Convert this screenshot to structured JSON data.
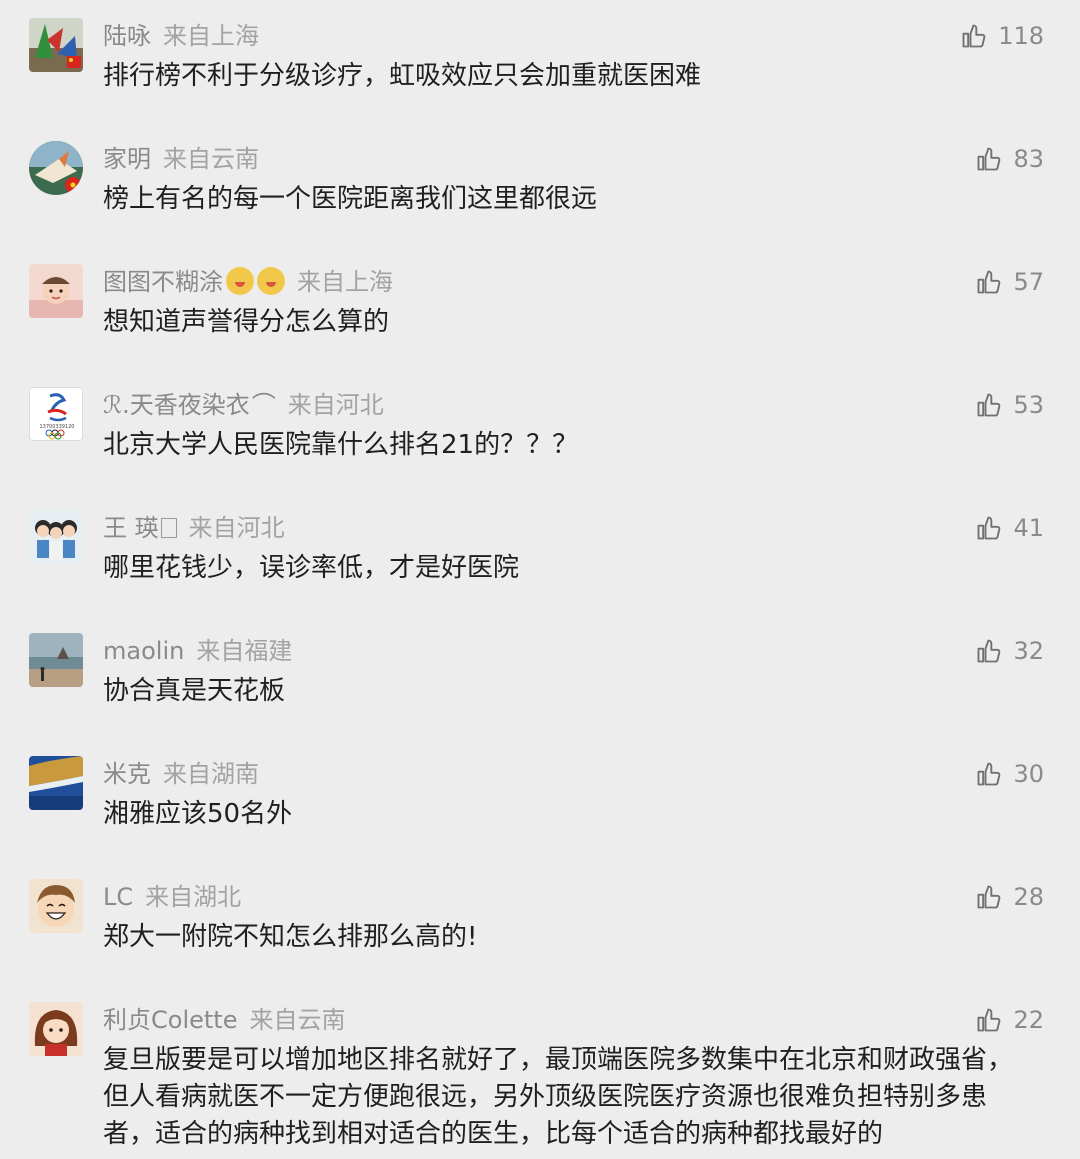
{
  "comments": [
    {
      "user": "陆咏",
      "location": "来自上海",
      "likes": "118",
      "text": "排行榜不利于分级诊疗，虹吸效应只会加重就医困难",
      "avatar": "avatar-flags"
    },
    {
      "user": "家明",
      "location": "来自云南",
      "likes": "83",
      "text": "榜上有名的每一个医院距离我们这里都很远",
      "avatar": "avatar-paper-crane"
    },
    {
      "user": "图图不糊涂",
      "location": "来自上海",
      "likes": "57",
      "text": "想知道声誉得分怎么算的",
      "avatar": "avatar-baby"
    },
    {
      "user": "ℛ.天香夜染衣",
      "location": "来自河北",
      "likes": "53",
      "text": "北京大学人民医院靠什么排名21的？？？",
      "avatar": "avatar-olympic-logo",
      "avatar_caption": "13700339120"
    },
    {
      "user": "王 瑛",
      "location": "来自河北",
      "likes": "41",
      "text": "哪里花钱少，误诊率低，才是好医院",
      "avatar": "avatar-cartoon-kids"
    },
    {
      "user": "maolin",
      "location": "来自福建",
      "likes": "32",
      "text": "协合真是天花板",
      "avatar": "avatar-beach"
    },
    {
      "user": "米克",
      "location": "来自湖南",
      "likes": "30",
      "text": "湘雅应该50名外",
      "avatar": "avatar-sea"
    },
    {
      "user": "LC",
      "location": "来自湖北",
      "likes": "28",
      "text": "郑大一附院不知怎么排那么高的!",
      "avatar": "avatar-cartoon-boy"
    },
    {
      "user": "利贞Colette",
      "location": "来自云南",
      "likes": "22",
      "text": "复旦版要是可以增加地区排名就好了，最顶端医院多数集中在北京和财政强省，但人看病就医不一定方便跑很远，另外顶级医院医疗资源也很难负担特别多患者，适合的病种找到相对适合的医生，比每个适合的病种都找最好的",
      "avatar": "avatar-cartoon-girl"
    }
  ],
  "colors": {
    "background": "#ededed",
    "meta": "#8a8a8a",
    "text": "#1f1f1f"
  },
  "icons": {
    "like": "thumbs-up-icon"
  }
}
